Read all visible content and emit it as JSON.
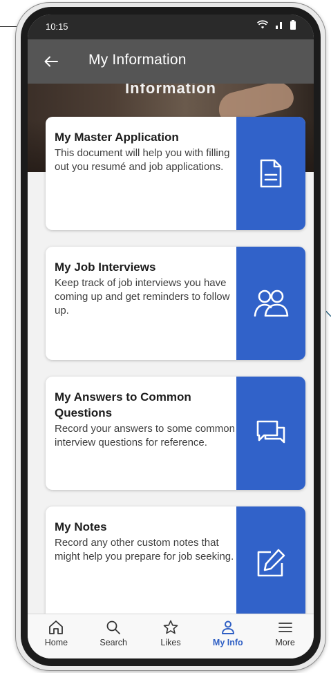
{
  "status_bar": {
    "time": "10:15"
  },
  "app_bar": {
    "title": "My Information"
  },
  "hero": {
    "title": "Information"
  },
  "cards": [
    {
      "title": "My Master Application",
      "description": "This document will help you with filling out you resumé and job applications.",
      "icon": "document-icon"
    },
    {
      "title": "My Job Interviews",
      "description": "Keep track of job interviews you have coming up and get reminders to follow up.",
      "icon": "people-icon"
    },
    {
      "title": "My Answers to Common Questions",
      "description": "Record your answers to some common interview questions for reference.",
      "icon": "chat-bubbles-icon"
    },
    {
      "title": "My Notes",
      "description": "Record any other custom notes that might help you prepare for job seeking.",
      "icon": "edit-note-icon"
    }
  ],
  "tabs": [
    {
      "label": "Home",
      "icon": "home-icon",
      "active": false
    },
    {
      "label": "Search",
      "icon": "search-icon",
      "active": false
    },
    {
      "label": "Likes",
      "icon": "star-icon",
      "active": false
    },
    {
      "label": "My Info",
      "icon": "person-icon",
      "active": true
    },
    {
      "label": "More",
      "icon": "menu-icon",
      "active": false
    }
  ],
  "colors": {
    "accent": "#3162c9",
    "active_tab": "#2f5fc4",
    "app_bar": "#555555",
    "status_bar": "#2a2a2a"
  }
}
